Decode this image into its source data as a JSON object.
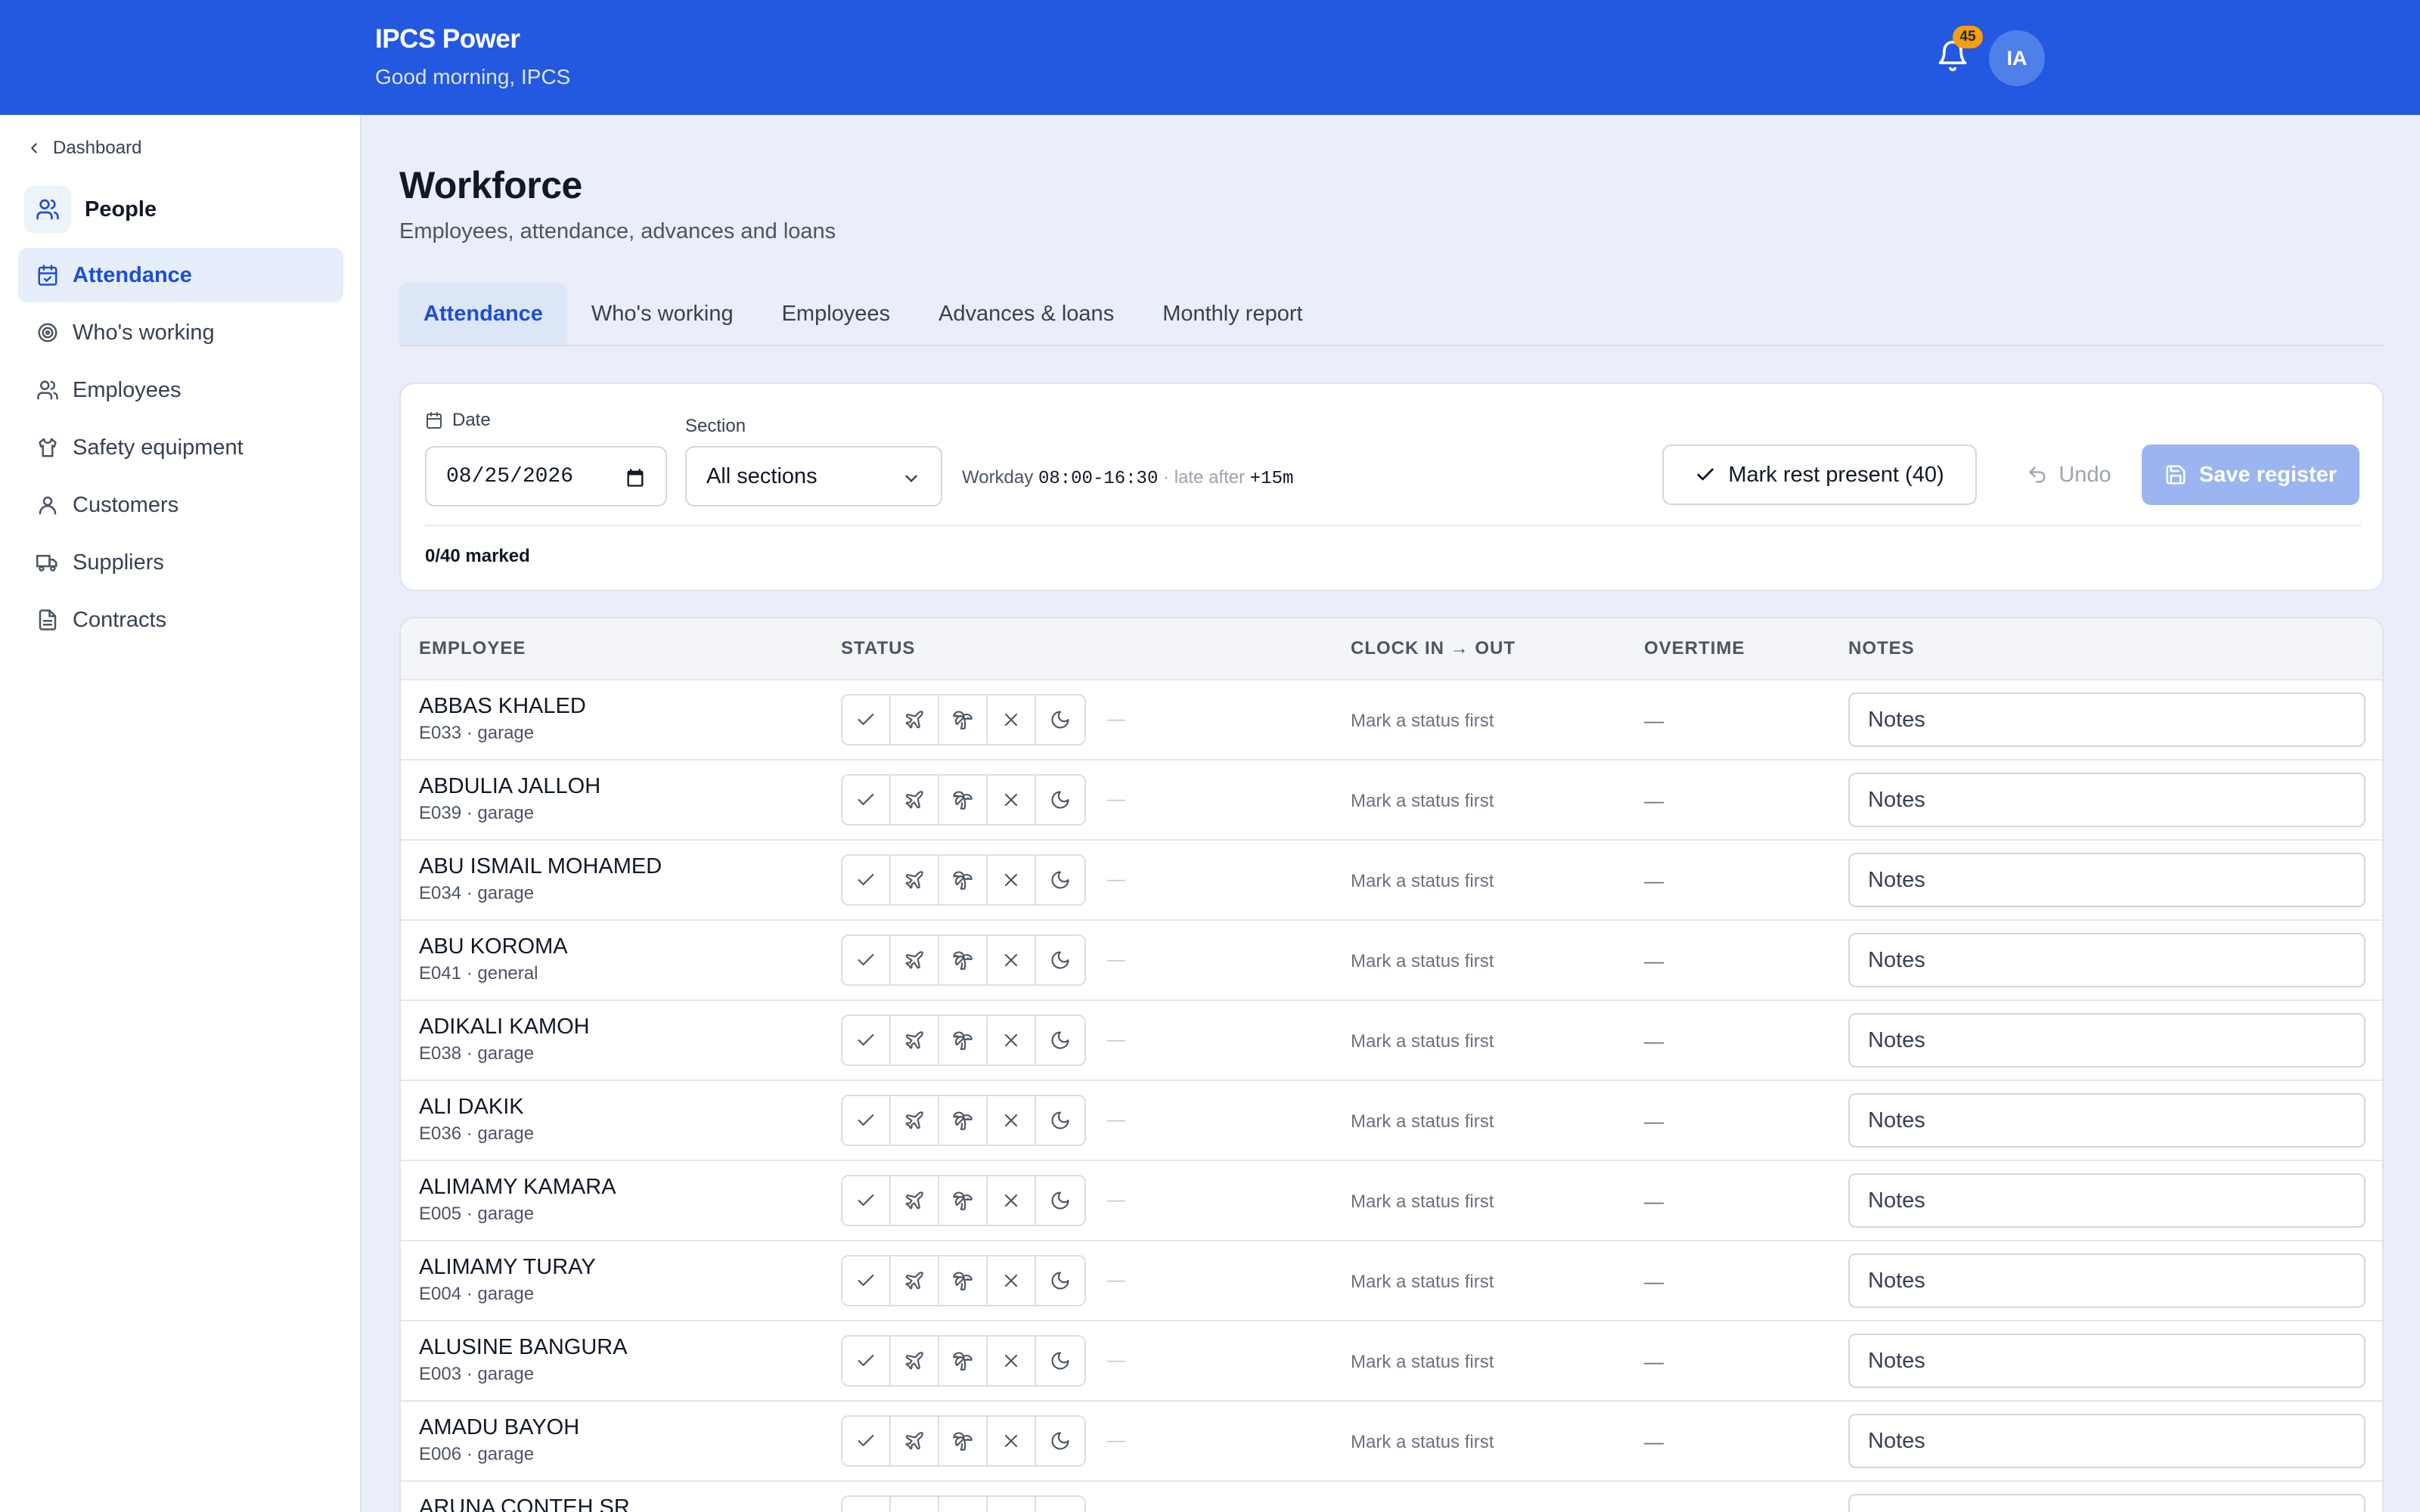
{
  "header": {
    "app_name": "IPCS Power",
    "greeting": "Good morning, IPCS",
    "notifications_count": "45",
    "avatar_initials": "IA",
    "accent_color": "#2358e0"
  },
  "sidebar": {
    "back_label": "Dashboard",
    "section_title": "People",
    "items": [
      {
        "label": "Attendance",
        "icon": "calendar-check-icon",
        "active": true
      },
      {
        "label": "Who's working",
        "icon": "target-icon",
        "active": false
      },
      {
        "label": "Employees",
        "icon": "users-icon",
        "active": false
      },
      {
        "label": "Safety equipment",
        "icon": "shirt-icon",
        "active": false
      },
      {
        "label": "Customers",
        "icon": "user-icon",
        "active": false
      },
      {
        "label": "Suppliers",
        "icon": "truck-icon",
        "active": false
      },
      {
        "label": "Contracts",
        "icon": "document-icon",
        "active": false
      }
    ]
  },
  "main": {
    "title": "Workforce",
    "subtitle": "Employees, attendance, advances and loans",
    "tabs": [
      {
        "label": "Attendance",
        "active": true
      },
      {
        "label": "Who's working",
        "active": false
      },
      {
        "label": "Employees",
        "active": false
      },
      {
        "label": "Advances & loans",
        "active": false
      },
      {
        "label": "Monthly report",
        "active": false
      }
    ]
  },
  "filters": {
    "date_label": "Date",
    "date_value": "08/25/2026",
    "section_label": "Section",
    "section_value": "All sections",
    "workday_label": "Workday",
    "workday_hours": "08:00-16:30",
    "late_label": "· late after",
    "late_value": "+15m",
    "mark_rest_label": "Mark rest present (40)",
    "undo_label": "Undo",
    "save_label": "Save register",
    "marked_summary": "0/40 marked"
  },
  "table": {
    "headers": {
      "employee": "EMPLOYEE",
      "status": "STATUS",
      "clock": "CLOCK IN → OUT",
      "overtime": "OVERTIME",
      "notes": "NOTES"
    },
    "status_icons": [
      "check-icon",
      "plane-icon",
      "palm-tree-icon",
      "x-icon",
      "moon-icon"
    ],
    "clock_hint": "Mark a status first",
    "empty_value": "—",
    "notes_placeholder": "Notes",
    "rows": [
      {
        "name": "ABBAS KHALED",
        "meta": "E033 · garage"
      },
      {
        "name": "ABDULIA JALLOH",
        "meta": "E039 · garage"
      },
      {
        "name": "ABU ISMAIL MOHAMED",
        "meta": "E034 · garage"
      },
      {
        "name": "ABU KOROMA",
        "meta": "E041 · general"
      },
      {
        "name": "ADIKALI KAMOH",
        "meta": "E038 · garage"
      },
      {
        "name": "ALI DAKIK",
        "meta": "E036 · garage"
      },
      {
        "name": "ALIMAMY KAMARA",
        "meta": "E005 · garage"
      },
      {
        "name": "ALIMAMY TURAY",
        "meta": "E004 · garage"
      },
      {
        "name": "ALUSINE BANGURA",
        "meta": "E003 · garage"
      },
      {
        "name": "AMADU BAYOH",
        "meta": "E006 · garage"
      },
      {
        "name": "ARUNA CONTEH SR",
        "meta": ""
      }
    ]
  }
}
